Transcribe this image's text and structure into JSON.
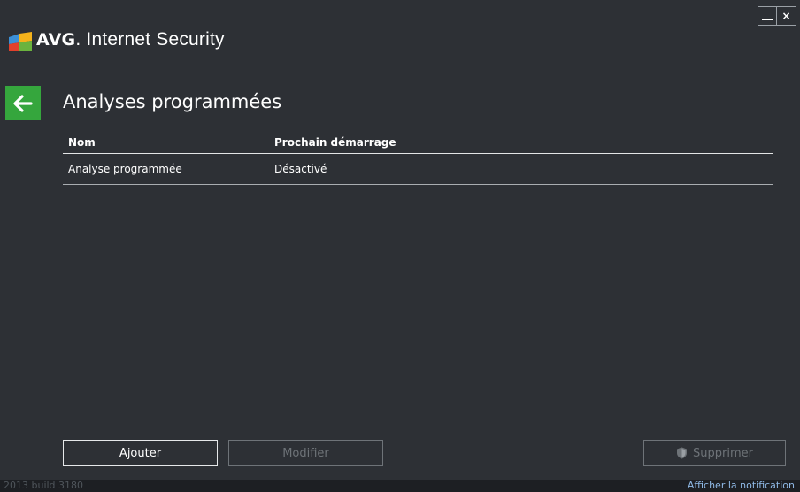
{
  "window": {
    "minimize_label": "_",
    "close_label": "×"
  },
  "header": {
    "brand": "AVG",
    "product": "Internet Security"
  },
  "page": {
    "title": "Analyses programmées"
  },
  "table": {
    "columns": [
      "Nom",
      "Prochain démarrage"
    ],
    "rows": [
      [
        "Analyse programmée",
        "Désactivé"
      ]
    ]
  },
  "buttons": {
    "add": "Ajouter",
    "edit": "Modifier",
    "delete": "Supprimer"
  },
  "status": {
    "build": "2013  build 3180",
    "notification_link": "Afficher la notification"
  },
  "colors": {
    "background": "#2d3035",
    "accent_green": "#35a63d",
    "link": "#8fb9e6"
  },
  "icons": {
    "back": "arrow-left-icon",
    "delete": "shield-icon"
  }
}
